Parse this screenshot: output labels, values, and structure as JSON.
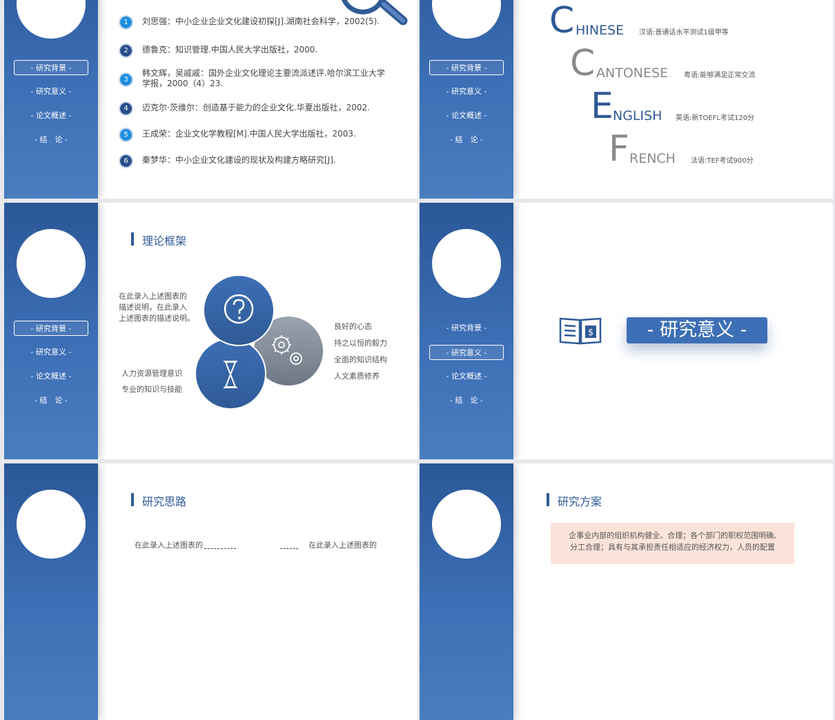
{
  "nav_items": [
    "- 研究背景 -",
    "- 研究意义 -",
    "- 论文概述 -",
    "- 结　论 -"
  ],
  "references": [
    {
      "num": "1",
      "text": "刘思强：中小企业企业文化建设初探[J].湖南社会科学，2002(5)."
    },
    {
      "num": "2",
      "text": "德鲁克：知识管理.中国人民大学出版社，2000."
    },
    {
      "num": "3",
      "text": "韩文辉，吴戚戚：国外企业文化理论主要流派述评.哈尔滨工业大学学报，2000（4）23."
    },
    {
      "num": "4",
      "text": "迈克尔·茨维尔：创造基于能力的企业文化.华夏出版社，2002."
    },
    {
      "num": "5",
      "text": "王成荣：企业文化学教程[M].中国人民大学出版社，2003."
    },
    {
      "num": "6",
      "text": "秦梦华：中小企业文化建设的现状及构建方略研究[J]."
    }
  ],
  "languages": [
    {
      "initial": "C",
      "rest": "HINESE",
      "desc": "汉语:普通话水平测试1级甲等",
      "color": "#2f5a96"
    },
    {
      "initial": "C",
      "rest": "ANTONESE",
      "desc": "粤语:能够满足正常交流",
      "color": "#8a8a8a"
    },
    {
      "initial": "E",
      "rest": "NGLISH",
      "desc": "英语:新TOEFL考试120分",
      "color": "#2f5a96"
    },
    {
      "initial": "F",
      "rest": "RENCH",
      "desc": "法语:TEF考试900分",
      "color": "#8a8a8a"
    }
  ],
  "theory": {
    "title": "理论框架",
    "desc_left": [
      "在此录入上述图表的",
      "描述说明，在此录入",
      "上述图表的描述说明。"
    ],
    "left_items": [
      "人力资源管理意识",
      "专业的知识与技能"
    ],
    "right_items": [
      "良好的心态",
      "持之以恒的毅力",
      "全面的知识结构",
      "人文素质修养"
    ],
    "icons": [
      "question-icon",
      "gears-icon",
      "hourglass-icon"
    ]
  },
  "significance": {
    "title": "- 研究意义 -",
    "icon": "book-dollar-icon"
  },
  "research_idea": {
    "title": "研究思路",
    "box_left": "在此录入上述图表的",
    "box_right": "在此录入上述图表的"
  },
  "research_plan": {
    "title": "研究方案",
    "lines": [
      "企事业内部的组织机构健全、合理；各个部门的职权范围明确,",
      "分工合理；具有与其承担责任相适应的经济权力，人员的配置"
    ]
  },
  "colors": {
    "primary": "#2f5a96",
    "accent_blue": "#1e8fe0",
    "plan_bg": "#fbe3da"
  }
}
